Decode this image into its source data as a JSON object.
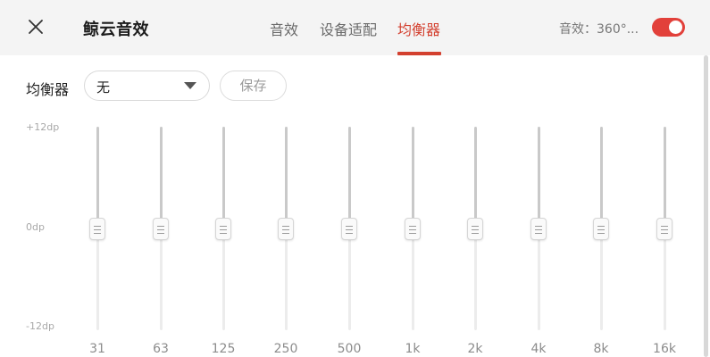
{
  "header": {
    "title": "鲸云音效",
    "tabs": [
      {
        "label": "音效",
        "active": false
      },
      {
        "label": "设备适配",
        "active": false
      },
      {
        "label": "均衡器",
        "active": true
      }
    ],
    "effect_status": "音效：360°...",
    "effect_enabled": true,
    "close_icon": "close-icon"
  },
  "equalizer": {
    "preset_label": "均衡器",
    "preset_value": "无",
    "save_label": "保存",
    "db_labels": {
      "max": "+12dp",
      "mid": "0dp",
      "min": "-12dp"
    },
    "bands": [
      {
        "freq": "31",
        "gain": 0
      },
      {
        "freq": "63",
        "gain": 0
      },
      {
        "freq": "125",
        "gain": 0
      },
      {
        "freq": "250",
        "gain": 0
      },
      {
        "freq": "500",
        "gain": 0
      },
      {
        "freq": "1k",
        "gain": 0
      },
      {
        "freq": "2k",
        "gain": 0
      },
      {
        "freq": "4k",
        "gain": 0
      },
      {
        "freq": "8k",
        "gain": 0
      },
      {
        "freq": "16k",
        "gain": 0
      }
    ]
  },
  "colors": {
    "accent": "#d3402f",
    "toggle_on": "#e2403a"
  }
}
